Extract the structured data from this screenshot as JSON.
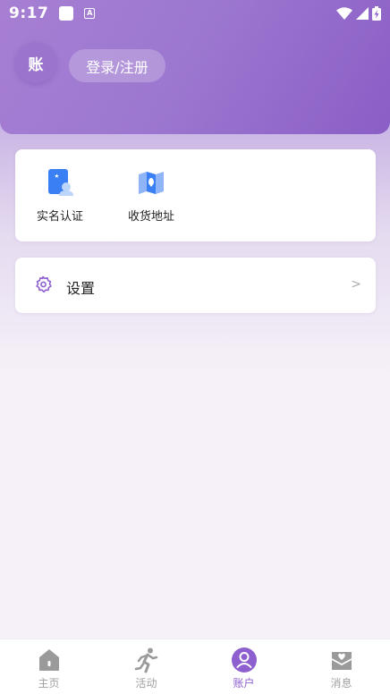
{
  "status_bar": {
    "time": "9:17",
    "icons": [
      "notification-square-icon",
      "app-a-icon",
      "wifi-icon",
      "signal-icon",
      "battery-charging-icon"
    ]
  },
  "header": {
    "avatar_text": "账",
    "login_label": "登录/注册"
  },
  "tools": [
    {
      "label": "实名认证",
      "icon": "id-card-icon"
    },
    {
      "label": "收货地址",
      "icon": "map-icon"
    }
  ],
  "settings": {
    "label": "设置",
    "icon": "gear-icon",
    "chevron": ">"
  },
  "tabbar": {
    "active": "账户",
    "items": [
      {
        "label": "主页",
        "icon": "home-icon"
      },
      {
        "label": "活动",
        "icon": "runner-icon"
      },
      {
        "label": "账户",
        "icon": "user-icon"
      },
      {
        "label": "消息",
        "icon": "message-heart-icon"
      }
    ]
  },
  "colors": {
    "accent": "#8e5fcf",
    "header_gradient": [
      "#a67fd3",
      "#8a5ec6"
    ],
    "inactive": "#a0a0a0"
  }
}
